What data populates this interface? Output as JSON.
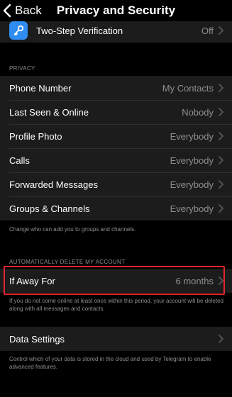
{
  "nav": {
    "back_label": "Back",
    "title": "Privacy and Security"
  },
  "security": {
    "two_step": {
      "label": "Two-Step Verification",
      "value": "Off",
      "icon": "key-icon"
    }
  },
  "privacy": {
    "header": "PRIVACY",
    "rows": [
      {
        "label": "Phone Number",
        "value": "My Contacts"
      },
      {
        "label": "Last Seen & Online",
        "value": "Nobody"
      },
      {
        "label": "Profile Photo",
        "value": "Everybody"
      },
      {
        "label": "Calls",
        "value": "Everybody"
      },
      {
        "label": "Forwarded Messages",
        "value": "Everybody"
      },
      {
        "label": "Groups & Channels",
        "value": "Everybody"
      }
    ],
    "footer": "Change who can add you to groups and channels."
  },
  "auto_delete": {
    "header": "AUTOMATICALLY DELETE MY ACCOUNT",
    "row": {
      "label": "If Away For",
      "value": "6 months"
    },
    "footer": "If you do not come online at least once within this period, your account will be deleted along with all messages and contacts."
  },
  "data": {
    "row": {
      "label": "Data Settings"
    },
    "footer": "Control which of your data is stored in the cloud and used by Telegram to enable advanced features."
  },
  "colors": {
    "background": "#000000",
    "cell": "#1c1c1d",
    "secondary_text": "#8e8e93",
    "icon_blue": "#2f8cf0",
    "highlight_red": "#e0262d"
  }
}
